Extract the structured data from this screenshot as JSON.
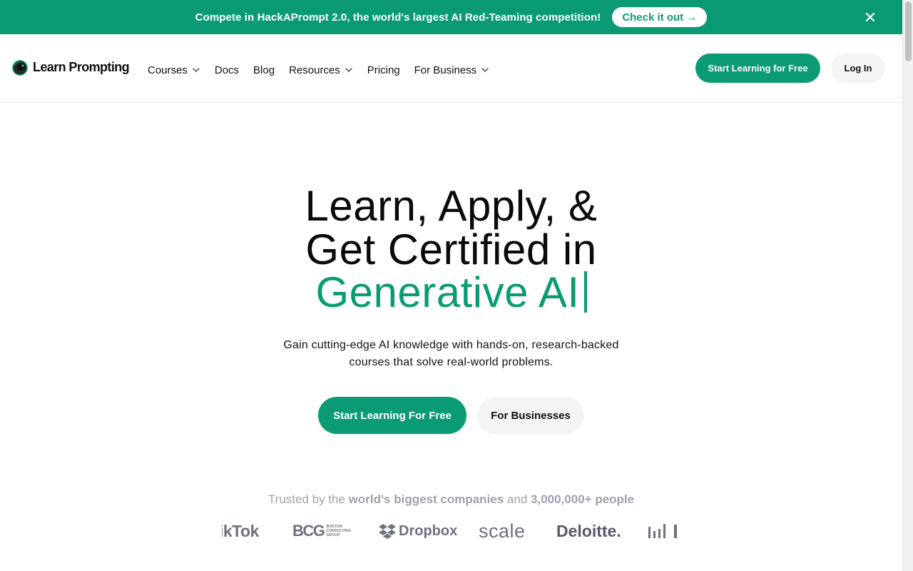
{
  "banner": {
    "text": "Compete in HackAPrompt 2.0, the world's largest AI Red-Teaming competition!",
    "cta_label": "Check it out →",
    "close_icon": "close-icon",
    "bg_color": "#0b9b74"
  },
  "header": {
    "logo_text": "Learn Prompting",
    "logo_icon": "astronaut-helmet-icon",
    "nav": [
      {
        "label": "Courses",
        "has_dropdown": true
      },
      {
        "label": "Docs",
        "has_dropdown": false
      },
      {
        "label": "Blog",
        "has_dropdown": false
      },
      {
        "label": "Resources",
        "has_dropdown": true
      },
      {
        "label": "Pricing",
        "has_dropdown": false
      },
      {
        "label": "For Business",
        "has_dropdown": true
      }
    ],
    "start_label": "Start Learning for Free",
    "login_label": "Log In"
  },
  "hero": {
    "title_line1": "Learn, Apply, &",
    "title_line2": "Get Certified in",
    "title_line3": "Generative AI",
    "subtitle_line1": "Gain cutting-edge AI knowledge with hands-on, research-backed",
    "subtitle_line2": "courses that solve real-world problems.",
    "primary_cta": "Start Learning For Free",
    "secondary_cta": "For Businesses",
    "accent_color": "#0b9b74"
  },
  "trusted": {
    "prefix": "Trusted by the ",
    "highlight1": "world's biggest companies",
    "middle": " and ",
    "highlight2": "3,000,000+ people"
  },
  "brands": {
    "tiktok": "ikTok",
    "bcg": "BCG",
    "bcg_small_1": "BOSTON",
    "bcg_small_2": "CONSULTING",
    "bcg_small_3": "GROUP",
    "dropbox": "Dropbox",
    "scale": "scale",
    "deloitte": "Deloitte."
  }
}
